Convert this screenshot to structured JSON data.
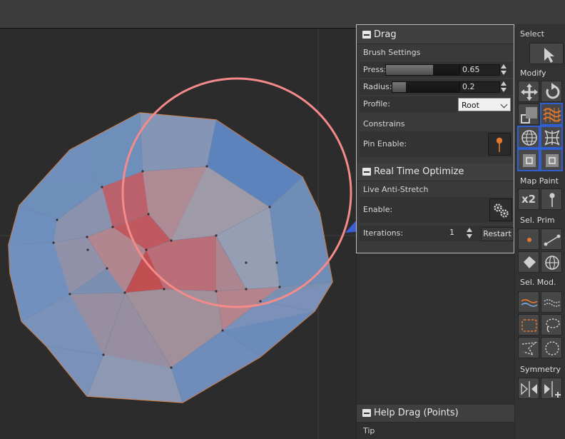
{
  "drag_panel": {
    "title": "Drag",
    "brush_settings": "Brush Settings",
    "press_label": "Press:",
    "press_value": "0.65",
    "press_level": 0.65,
    "radius_label": "Radius:",
    "radius_value": "0.2",
    "radius_level": 0.2,
    "profile_label": "Profile:",
    "profile_value": "Root",
    "constrains": "Constrains",
    "pin_enable_label": "Pin Enable:"
  },
  "rto_panel": {
    "title": "Real Time Optimize",
    "live_anti_stretch": "Live Anti-Stretch",
    "enable_label": "Enable:",
    "iterations_label": "Iterations:",
    "iterations_value": "1",
    "restart_label": "Restart"
  },
  "help_panel": {
    "title": "Help Drag (Points)",
    "tip": "Tip"
  },
  "toolbar": {
    "select": "Select",
    "modify": "Modify",
    "map_paint": "Map Paint",
    "x2": "x2",
    "sel_prim": "Sel. Prim",
    "sel_mod": "Sel. Mod.",
    "symmetry": "Symmetry"
  },
  "colors": {
    "accent_orange": "#e2782f",
    "highlight_blue": "#2f5fd0",
    "brush_circle": "#f58a8a",
    "mesh_blue": "#6a8ec0",
    "mesh_red": "#c84a4a"
  }
}
